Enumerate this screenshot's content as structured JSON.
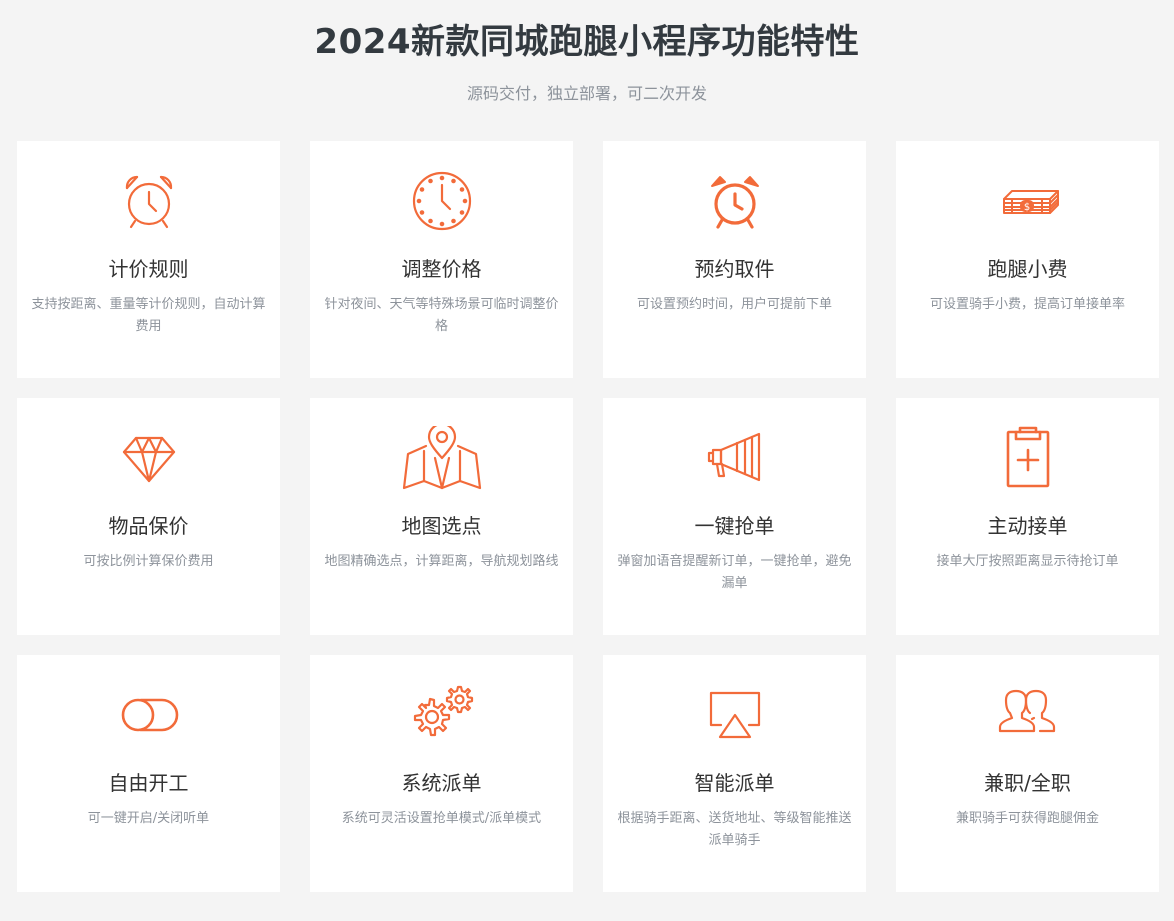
{
  "header": {
    "title": "2024新款同城跑腿小程序功能特性",
    "subtitle": "源码交付，独立部署，可二次开发"
  },
  "accent_color": "#f26b3a",
  "features": [
    {
      "icon": "alarm-clock-icon",
      "title": "计价规则",
      "desc": "支持按距离、重量等计价规则，自动计算费用"
    },
    {
      "icon": "clock-icon",
      "title": "调整价格",
      "desc": "针对夜间、天气等特殊场景可临时调整价格"
    },
    {
      "icon": "bell-alarm-icon",
      "title": "预约取件",
      "desc": "可设置预约时间，用户可提前下单"
    },
    {
      "icon": "money-stack-icon",
      "title": "跑腿小费",
      "desc": "可设置骑手小费，提高订单接单率"
    },
    {
      "icon": "diamond-icon",
      "title": "物品保价",
      "desc": "可按比例计算保价费用"
    },
    {
      "icon": "map-pin-icon",
      "title": "地图选点",
      "desc": "地图精确选点，计算距离，导航规划路线"
    },
    {
      "icon": "megaphone-icon",
      "title": "一键抢单",
      "desc": "弹窗加语音提醒新订单，一键抢单，避免漏单"
    },
    {
      "icon": "clipboard-plus-icon",
      "title": "主动接单",
      "desc": "接单大厅按照距离显示待抢订单"
    },
    {
      "icon": "toggle-icon",
      "title": "自由开工",
      "desc": "可一键开启/关闭听单"
    },
    {
      "icon": "gears-icon",
      "title": "系统派单",
      "desc": "系统可灵活设置抢单模式/派单模式"
    },
    {
      "icon": "airplay-icon",
      "title": "智能派单",
      "desc": "根据骑手距离、送货地址、等级智能推送派单骑手"
    },
    {
      "icon": "users-icon",
      "title": "兼职/全职",
      "desc": "兼职骑手可获得跑腿佣金"
    }
  ]
}
